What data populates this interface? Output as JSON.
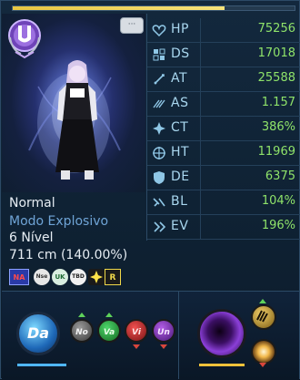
{
  "progress": {
    "value": 0.75
  },
  "chat_button": {
    "label": "···"
  },
  "character": {
    "mode": "Normal",
    "combat_mode": "Modo Explosivo",
    "level": "6 Nível",
    "height": "711 cm (140.00%)"
  },
  "stats": [
    {
      "label": "HP",
      "value": "75256",
      "icon": "heart-icon"
    },
    {
      "label": "DS",
      "value": "17018",
      "icon": "ds-grid-icon"
    },
    {
      "label": "AT",
      "value": "25588",
      "icon": "sword-icon"
    },
    {
      "label": "AS",
      "value": "1.157",
      "icon": "attack-speed-icon"
    },
    {
      "label": "CT",
      "value": "386%",
      "icon": "critical-icon"
    },
    {
      "label": "HT",
      "value": "11969",
      "icon": "crosshair-icon"
    },
    {
      "label": "DE",
      "value": "6375",
      "icon": "shield-icon"
    },
    {
      "label": "BL",
      "value": "104%",
      "icon": "block-icon"
    },
    {
      "label": "EV",
      "value": "196%",
      "icon": "evade-icon"
    }
  ],
  "badges": [
    "NA",
    "Nse",
    "UK",
    "TBD",
    "",
    "R"
  ],
  "evolution": {
    "main": "Da",
    "modes": [
      "No",
      "Va",
      "Vi",
      "Un"
    ]
  },
  "colors": {
    "stat_value": "#8fe36a",
    "stat_label": "#a9d7ef",
    "progress": "#e8c641",
    "status_white": "#e6edf3",
    "status_blue": "#6fa4d6"
  }
}
